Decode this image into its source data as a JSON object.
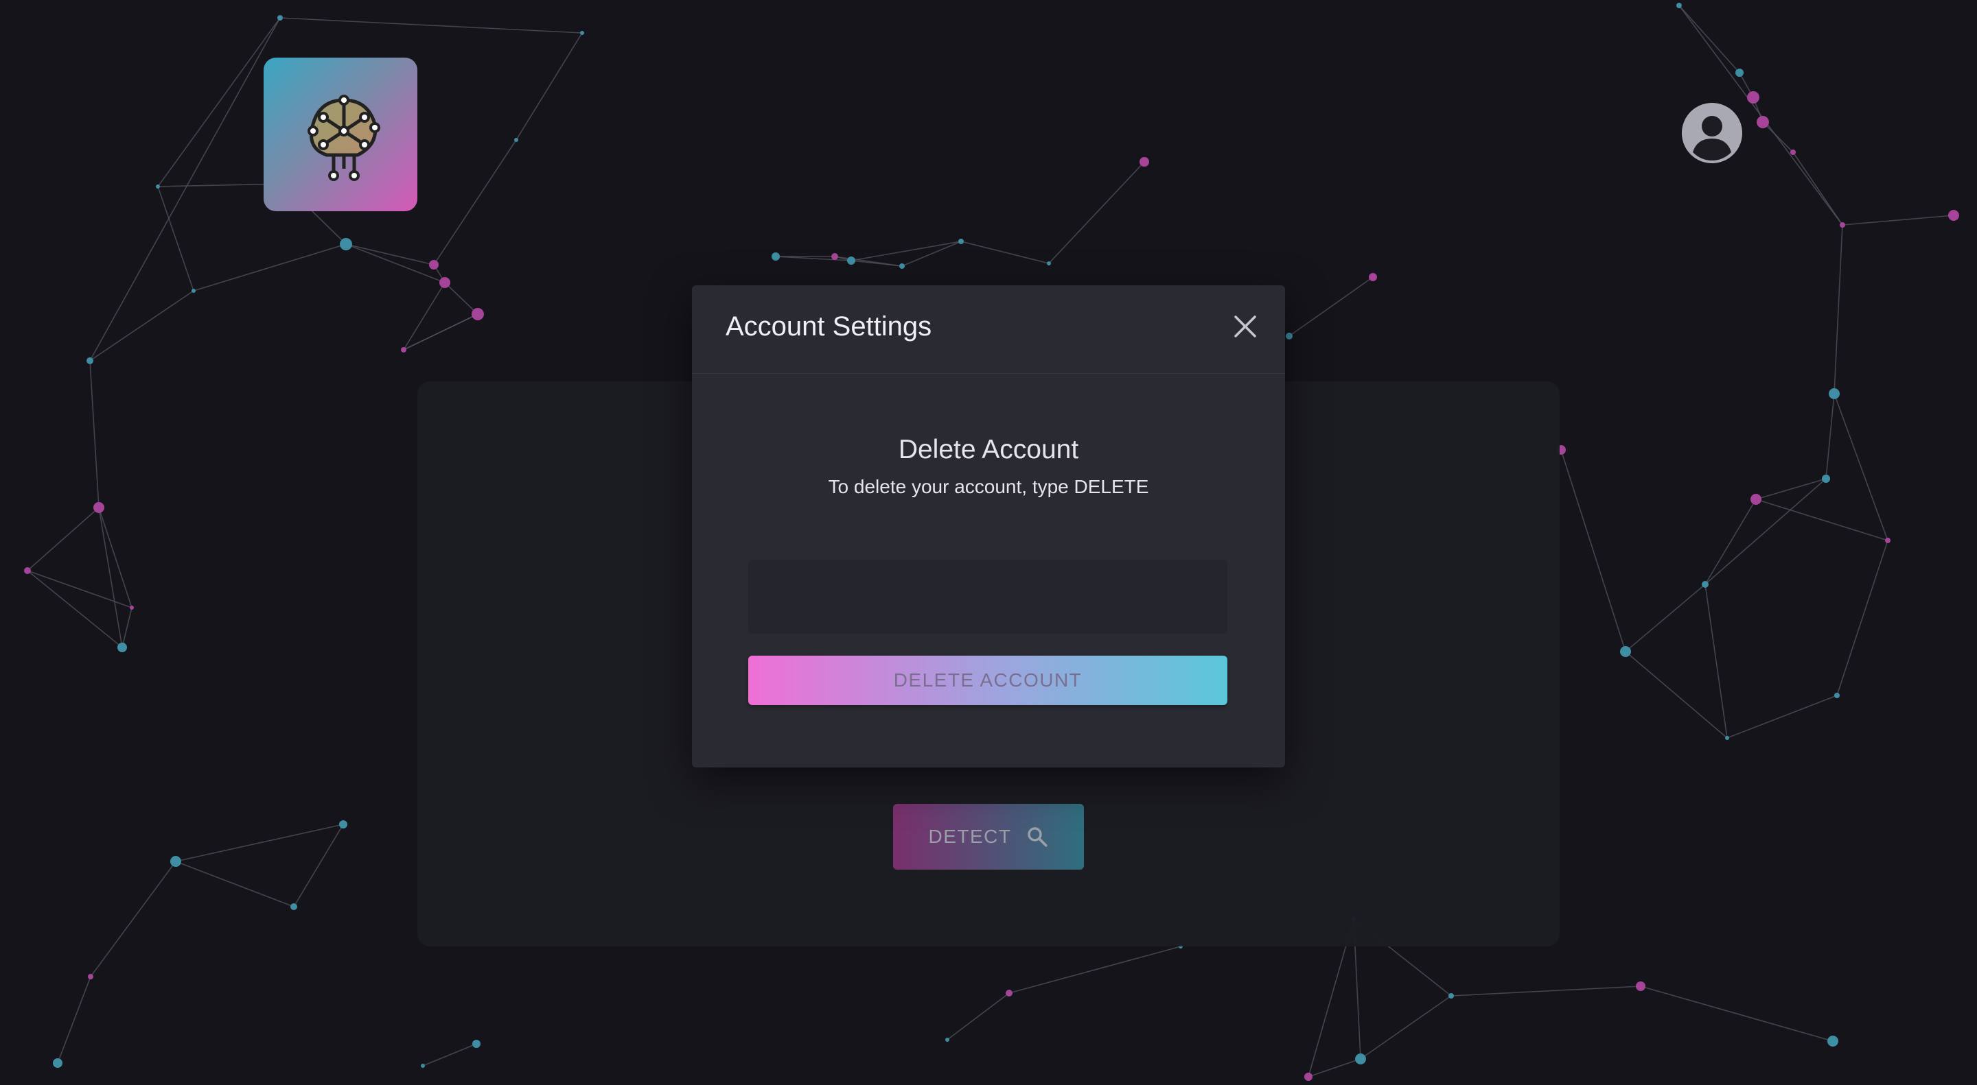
{
  "dialog": {
    "title": "Account Settings",
    "section_title": "Delete Account",
    "instruction": "To delete your account, type DELETE",
    "input_value": "",
    "input_placeholder": "",
    "delete_button_label": "DELETE ACCOUNT"
  },
  "main": {
    "detect_button_label": "DETECT"
  },
  "icons": {
    "logo": "brain-network-icon",
    "user": "user-avatar-icon",
    "close": "close-icon",
    "search": "search-icon"
  },
  "colors": {
    "background": "#14141a",
    "dialog": "#2a2a33",
    "accent_pink": "#ef6fd6",
    "accent_cyan": "#5ac7d8"
  }
}
